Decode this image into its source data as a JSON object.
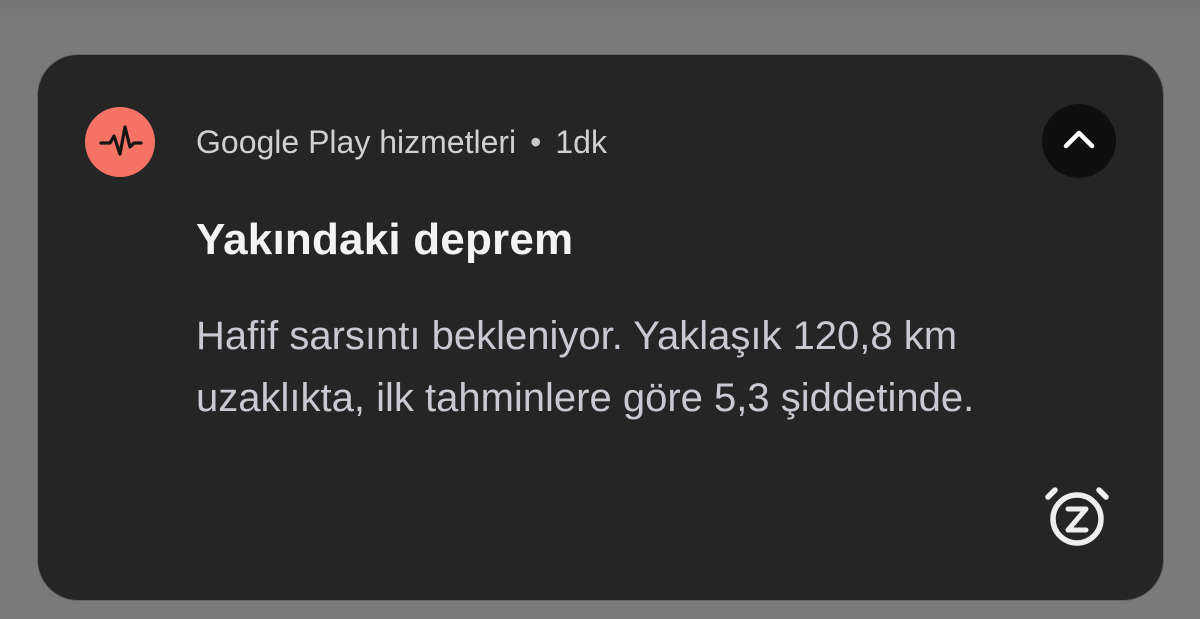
{
  "notification": {
    "app_name": "Google Play hizmetleri",
    "separator": "•",
    "timestamp": "1dk",
    "title": "Yakındaki deprem",
    "message_lines": [
      "Hafif sarsıntı bekleniyor. Yaklaşık 120,8 km",
      "uzaklıkta, ilk tahminlere göre 5,3 şiddetinde."
    ]
  },
  "icons": {
    "app_icon": "earthquake-pulse-icon",
    "expand_icon": "chevron-up-icon",
    "snooze_icon": "snooze-alarm-icon"
  },
  "colors": {
    "background": "#7a7a7a",
    "card": "#252526",
    "accent": "#f47364",
    "text_primary": "#f3f3f3",
    "text_secondary": "#c9c9d1"
  }
}
